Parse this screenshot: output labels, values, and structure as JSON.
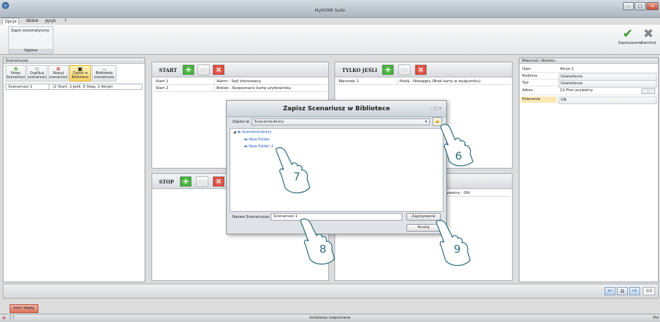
{
  "window": {
    "title": "MyHOME Suite"
  },
  "menu": {
    "items": [
      "Opcje",
      "Widok",
      "Język",
      "?"
    ]
  },
  "ribbon": {
    "autosave_label": "Zapis automatyczny",
    "group_caption": "Ogólne",
    "save_label": "Zapisywanie",
    "close_label": "Zamknij"
  },
  "left": {
    "title": "Scenariusze",
    "buttons": [
      {
        "label": "Nowy\nScenariusz",
        "icon": "add-icon"
      },
      {
        "label": "Duplikuj\nscenariusz",
        "icon": "copy-icon"
      },
      {
        "label": "Skasuj\nscenariusz",
        "icon": "delete-icon"
      },
      {
        "label": "Zapisz w\nBibliotece",
        "icon": "floppy-icon"
      },
      {
        "label": "Biblioteka\nscenariuszy",
        "icon": "library-icon"
      }
    ],
    "scenario_name": "Scenariusz 1",
    "scenario_summary": "(2 Start, 1 Jeśli, 0 Stop, 1 Akcje)"
  },
  "start": {
    "title": "START",
    "rows": [
      {
        "name": "Start 1",
        "desc": "Alarm - Sejf sforsowany"
      },
      {
        "name": "Start 2",
        "desc": "Brelok - Rozpoznano kartę użytkownika"
      }
    ]
  },
  "only_if": {
    "title": "TYLKO JEŚLI",
    "rows": [
      {
        "name": "Warunek 1",
        "desc": "Pokój - Niezajęty (Brak karty w wyłączniku)"
      }
    ]
  },
  "stop": {
    "title": "STOP"
  },
  "action_snippet": "ywatny - ON",
  "properties": {
    "title": "Własność Obiektu",
    "rows": [
      {
        "key": "Opis",
        "value": "Akcja 1",
        "combo": false
      },
      {
        "key": "Rodzina",
        "value": "Oświetlenie",
        "combo": true
      },
      {
        "key": "Typ",
        "value": "Oświetlenie",
        "combo": true
      },
      {
        "key": "Adres",
        "value": "11-Pion prywatny",
        "combo": false
      },
      {
        "key": "Polecenie",
        "value": "ON",
        "combo": true
      }
    ],
    "browse_label": "..."
  },
  "dialog": {
    "title": "Zapisz Scenariusz w Bibliotece",
    "save_in_label": "Zapisz w:",
    "save_in_value": "ScenarioLibrary",
    "tree": {
      "root": "ScenarioLibrary",
      "children": [
        "New Folder",
        "New Folder 2"
      ]
    },
    "name_label": "Nazwa Scenariusza:",
    "name_value": "Scenariusz 1",
    "save_button": "Zapisywanie",
    "cancel_button": "Anuluj"
  },
  "callouts": [
    "6",
    "7",
    "8",
    "9"
  ],
  "footer": {
    "page": "2/2",
    "tab_label": "Info i błędy"
  },
  "status": {
    "text": "Instalacja rozpoznana",
    "right": "Poł"
  },
  "colors": {
    "accent": "#f7d46a",
    "link": "#1a56c9",
    "callout": "#2f6e7d"
  }
}
